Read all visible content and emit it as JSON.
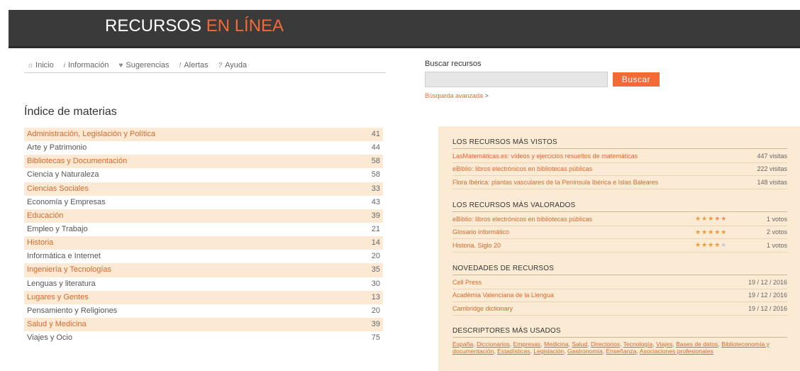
{
  "header": {
    "title_main": "RECURSOS ",
    "title_accent": "EN LÍNEA"
  },
  "nav": {
    "items": [
      {
        "icon": "home-icon",
        "glyph": "⌂",
        "label": "Inicio"
      },
      {
        "icon": "info-icon",
        "glyph": "i",
        "label": "Información"
      },
      {
        "icon": "heart-icon",
        "glyph": "♥",
        "label": "Sugerencias"
      },
      {
        "icon": "alert-icon",
        "glyph": "!",
        "label": "Alertas"
      },
      {
        "icon": "help-icon",
        "glyph": "?",
        "label": "Ayuda"
      }
    ]
  },
  "search": {
    "label": "Buscar recursos",
    "value": "",
    "button": "Buscar",
    "advanced": "Búsqueda avanzada",
    "advanced_arrow": ">"
  },
  "index": {
    "title": "Índice de materias",
    "items": [
      {
        "name": "Administración, Legislación y Política",
        "count": "41"
      },
      {
        "name": "Arte y Patrimonio",
        "count": "44"
      },
      {
        "name": "Bibliotecas y Documentación",
        "count": "58"
      },
      {
        "name": "Ciencia y Naturaleza",
        "count": "58"
      },
      {
        "name": "Ciencias Sociales",
        "count": "33"
      },
      {
        "name": "Economía y Empresas",
        "count": "43"
      },
      {
        "name": "Educación",
        "count": "39"
      },
      {
        "name": "Empleo y Trabajo",
        "count": "21"
      },
      {
        "name": "Historia",
        "count": "14"
      },
      {
        "name": "Informática e Internet",
        "count": "20"
      },
      {
        "name": "Ingeniería y Tecnologías",
        "count": "35"
      },
      {
        "name": "Lenguas y literatura",
        "count": "30"
      },
      {
        "name": "Lugares y Gentes",
        "count": "13"
      },
      {
        "name": "Pensamiento y Religiones",
        "count": "20"
      },
      {
        "name": "Salud y Medicina",
        "count": "39"
      },
      {
        "name": "Viajes y Ocio",
        "count": "75"
      }
    ]
  },
  "most_viewed": {
    "title": "LOS RECURSOS MÁS VISTOS",
    "items": [
      {
        "name": "LasMatemáticas.es: vídeos y ejercicios resueltos de matemáticas",
        "value": "447 visitas"
      },
      {
        "name": "eBiblio: libros electrónicos en bibliotecas públicas",
        "value": "222 visitas"
      },
      {
        "name": "Flora Ibérica: plantas vasculares de la Península Ibérica e Islas Baleares",
        "value": "148 visitas"
      }
    ]
  },
  "top_rated": {
    "title": "LOS RECURSOS MÁS VALORADOS",
    "items": [
      {
        "name": "eBiblio: libros electrónicos en bibliotecas públicas",
        "stars_on": "★★★★★",
        "stars_off": "",
        "rating": 5,
        "votes": "1 votos"
      },
      {
        "name": "Glosario informático",
        "stars_on": "★★★★★",
        "stars_off": "",
        "rating": 5,
        "votes": "2 votos"
      },
      {
        "name": "Historia. Siglo 20",
        "stars_on": "★★★★",
        "stars_off": "★",
        "rating": 4,
        "votes": "1 votos"
      }
    ]
  },
  "new_resources": {
    "title": "NOVEDADES DE RECURSOS",
    "items": [
      {
        "name": "Cell Press",
        "date": "19 / 12 / 2016"
      },
      {
        "name": "Acadèmia Valenciana de la Llengua",
        "date": "19 / 12 / 2016"
      },
      {
        "name": "Cambridge dictionary",
        "date": "19 / 12 / 2016"
      }
    ]
  },
  "descriptors": {
    "title": "DESCRIPTORES MÁS USADOS",
    "items": [
      "España",
      "Diccionarios",
      "Empresas",
      "Medicina",
      "Salud",
      "Directorios",
      "Tecnología",
      "Viajes",
      "Bases de datos",
      "Biblioteconomía y documentación",
      "Estadísticas",
      "Legislación",
      "Gastronomía",
      "Enseñanza",
      "Asociaciones profesionales"
    ]
  }
}
